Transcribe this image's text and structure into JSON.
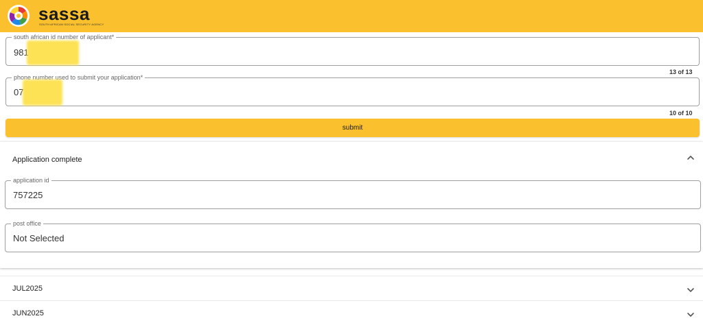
{
  "header": {
    "brand": "sassa",
    "brand_sub": "SOUTH AFRICAN SOCIAL SECURITY AGENCY",
    "logo_icon": "sassa-logo-icon",
    "bg_color": "#fbc02d"
  },
  "form": {
    "id_field": {
      "label": "south african id number of applicant*",
      "value": "981",
      "counter": "13 of 13"
    },
    "phone_field": {
      "label": "phone number used to submit your application*",
      "value": "07",
      "counter": "10 of 10"
    },
    "submit_label": "submit"
  },
  "application_panel": {
    "title": "Application complete",
    "expanded": true,
    "application_id": {
      "label": "application id",
      "value": "757225"
    },
    "post_office": {
      "label": "post office",
      "value": "Not Selected"
    }
  },
  "months": [
    {
      "label": "JUL2025"
    },
    {
      "label": "JUN2025"
    }
  ]
}
